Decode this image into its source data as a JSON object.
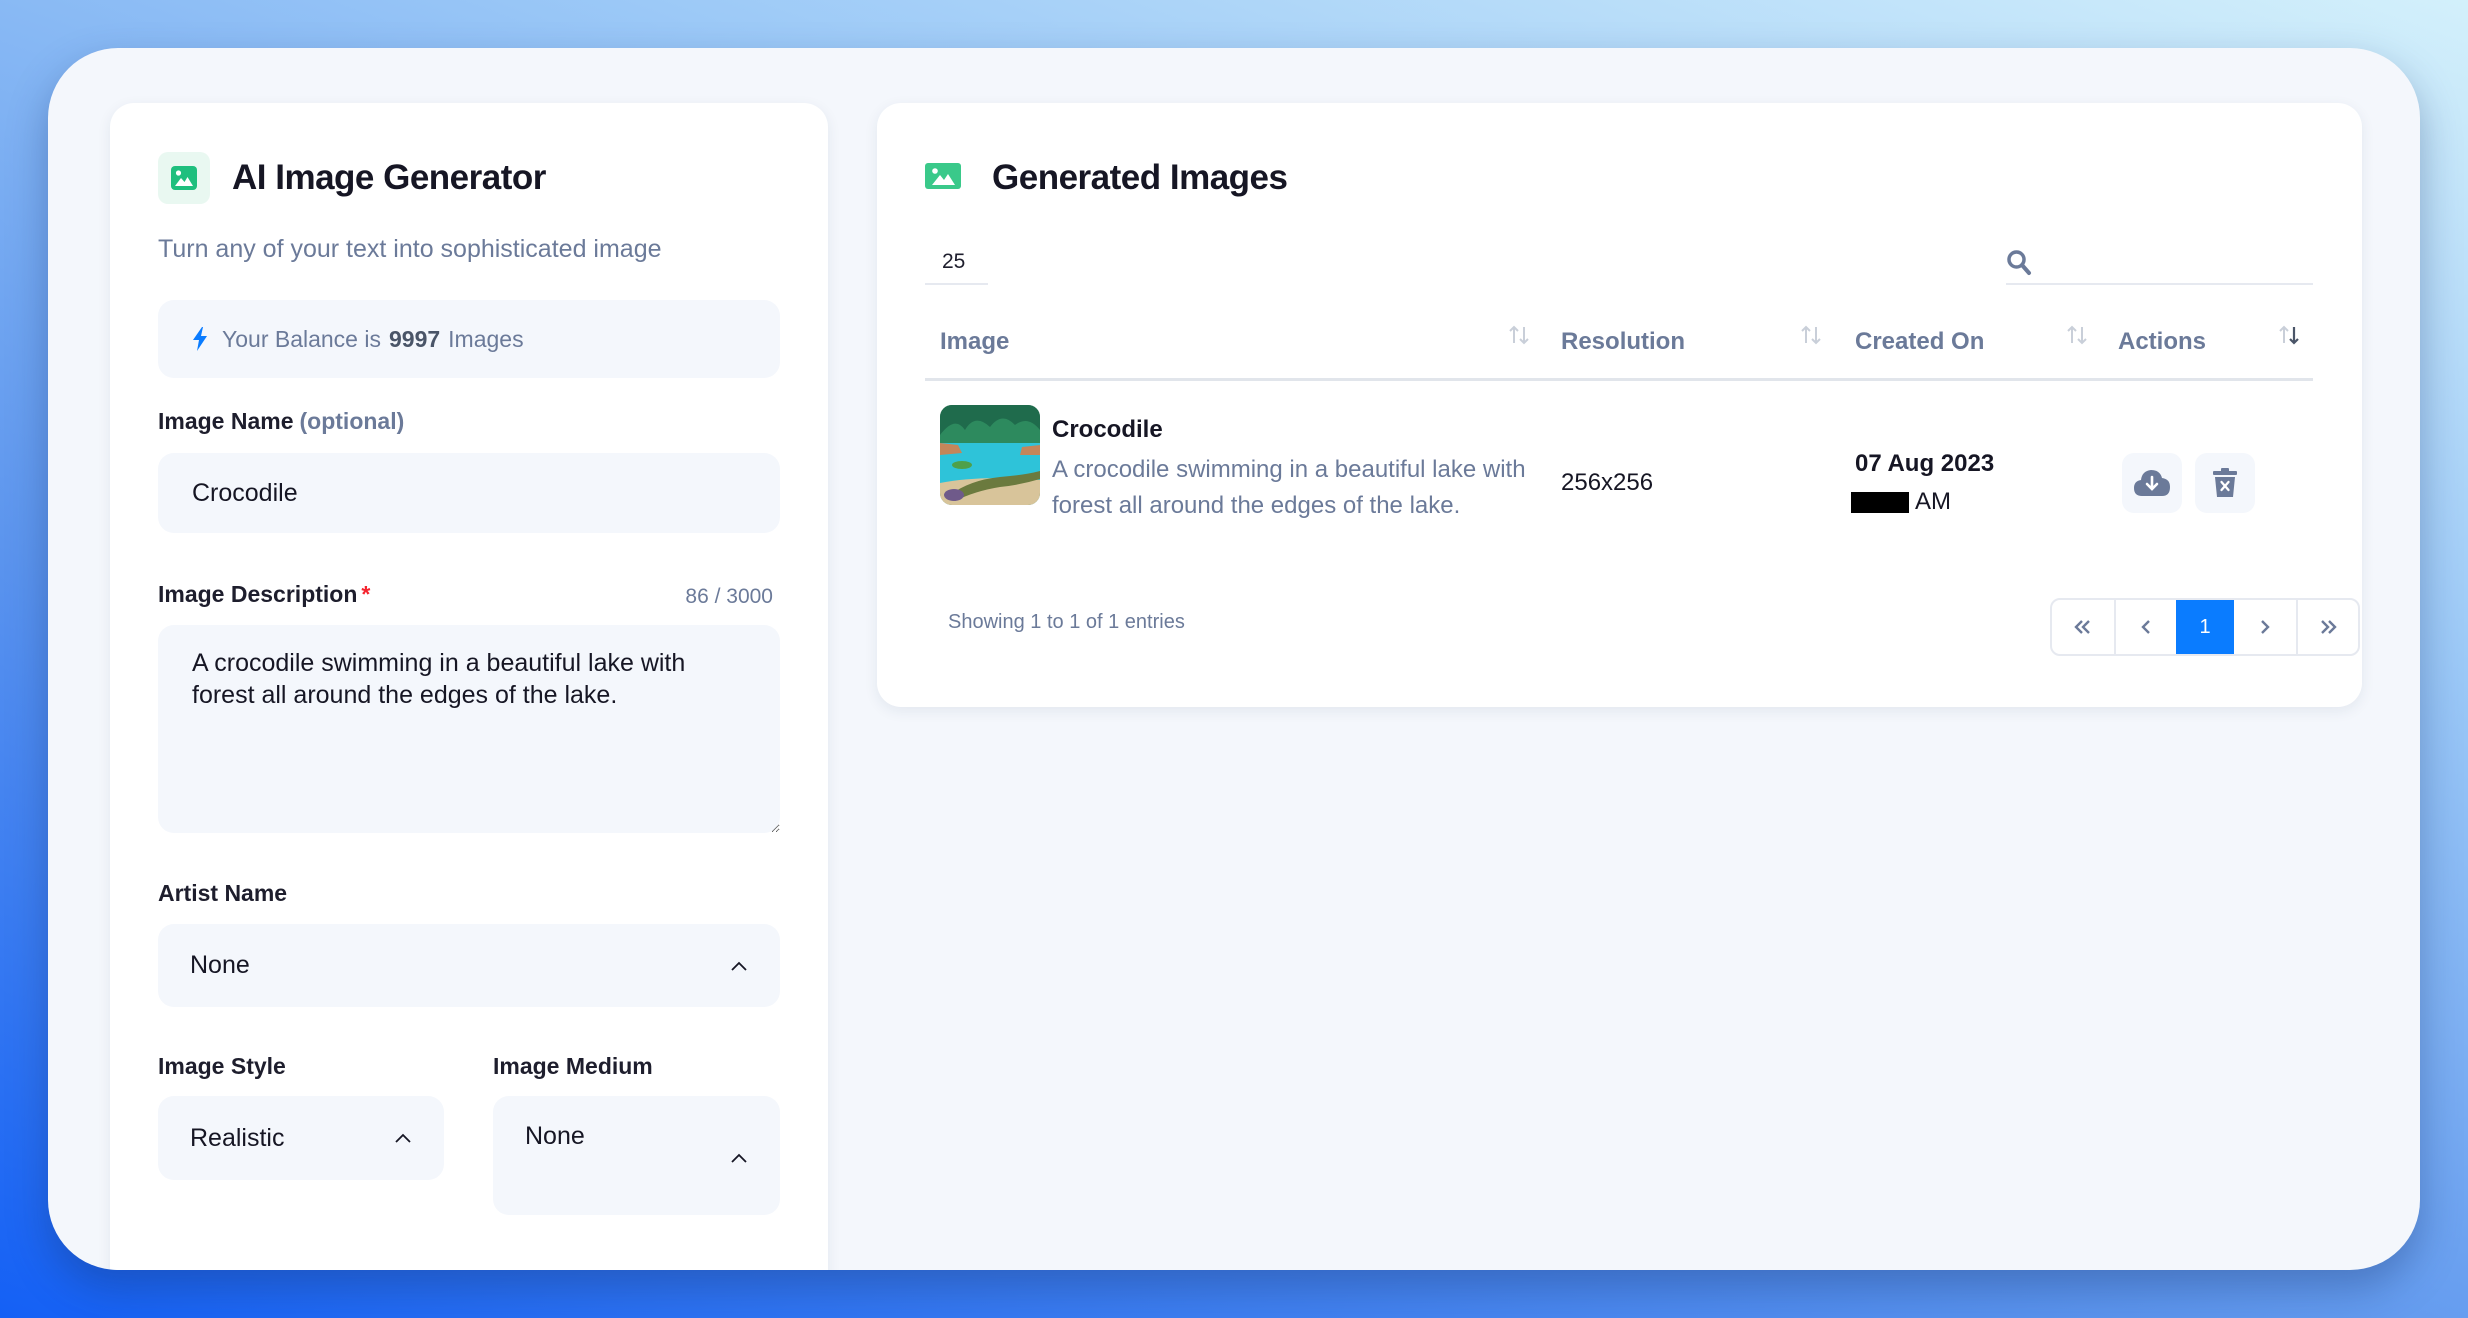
{
  "colors": {
    "accent_green": "#1fbf7e",
    "accent_blue": "#0a7cff",
    "required_red": "#f5222d",
    "muted_text": "#6b7a99"
  },
  "generator": {
    "icon": "image-icon",
    "title": "AI Image Generator",
    "subtitle": "Turn any of your text into sophisticated image",
    "balance": {
      "icon": "lightning-bolt-icon",
      "prefix": "Your Balance is",
      "amount": "9997",
      "suffix": "Images"
    },
    "image_name": {
      "label": "Image Name",
      "hint": "(optional)",
      "value": "Crocodile"
    },
    "image_description": {
      "label": "Image Description",
      "required_mark": "*",
      "counter": "86 / 3000",
      "value": "A crocodile swimming in a beautiful lake with forest all around the edges of the lake."
    },
    "artist_name": {
      "label": "Artist Name",
      "value": "None"
    },
    "image_style": {
      "label": "Image Style",
      "value": "Realistic"
    },
    "image_medium": {
      "label": "Image Medium",
      "value": "None"
    }
  },
  "gallery": {
    "icon": "image-icon",
    "title": "Generated Images",
    "per_page": "25",
    "search": {
      "icon": "search-icon",
      "placeholder": "",
      "value": ""
    },
    "columns": [
      {
        "label": "Image",
        "sort": "none"
      },
      {
        "label": "Resolution",
        "sort": "none"
      },
      {
        "label": "Created On",
        "sort": "none"
      },
      {
        "label": "Actions",
        "sort": "descending"
      }
    ],
    "rows": [
      {
        "thumbnail": "crocodile-lake-thumbnail",
        "name": "Crocodile",
        "description": "A crocodile swimming in a beautiful lake with forest all around the edges of the lake.",
        "resolution": "256x256",
        "date": "07 Aug 2023",
        "time_suffix": "AM",
        "time_redacted": true,
        "actions": [
          {
            "icon": "cloud-download-icon",
            "label": "Download"
          },
          {
            "icon": "trash-x-icon",
            "label": "Delete"
          }
        ]
      }
    ],
    "footer": {
      "info": "Showing 1 to 1 of 1 entries"
    },
    "pagination": {
      "first": "«",
      "prev": "‹",
      "current": "1",
      "next": "›",
      "last": "»"
    }
  }
}
